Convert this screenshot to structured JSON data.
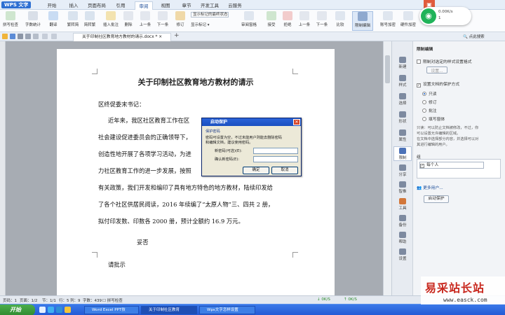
{
  "app": {
    "logo": "WPS 文字",
    "tabs": [
      "开始",
      "插入",
      "页面布局",
      "引用",
      "审阅",
      "视图",
      "章节",
      "开发工具",
      "云服务"
    ],
    "active_tab": "审阅"
  },
  "ribbon": {
    "groups": [
      "拼写检查",
      "字数统计",
      "翻译",
      "繁转简",
      "简转繁",
      "插入批注",
      "删除",
      "上一条",
      "下一条",
      "修订",
      "审阅窗格",
      "接受",
      "拒绝",
      "上一条",
      "下一条",
      "比较",
      "限制编辑",
      "账号加密",
      "硬件加密"
    ],
    "markup_select": "显示标记的最终状态",
    "show_markup": "显示标记"
  },
  "network": {
    "up": "0.00K/s",
    "down": "1"
  },
  "doc_tab": {
    "name": "关于印制社区教育地方教材的请示.docx *"
  },
  "document": {
    "title": "关于印制社区教育地方教材的请示",
    "salutation": "区终促委末书记：",
    "lines": [
      "近年来，我区社区教育工作在区",
      "社会建设促进委员会的正确领导下，",
      "创造性地开展了各项学习活动，为进",
      "力社区教育工作的进一步发展，按照",
      "有关政策，我们开发和编印了具有地方特色的地方教材，陆续印发给",
      "了各个社区供居民阅读，2016 年续编了“太原人物”三、四共 2 册，",
      "拟付印发数、印数各 2000 册，预计全额约 16.9 万元。"
    ],
    "sign": "妥否",
    "closing": "请批示"
  },
  "dialog": {
    "title": "启动保护",
    "section": "保护密码",
    "desc1": "密码可设置为空，不过未能用户则能去删除密码",
    "desc2": "和编辑文档，建议使用密码。",
    "new_pw_label": "新密码(可选)(E):",
    "confirm_pw_label": "确认新密码(E):",
    "ok": "确定",
    "cancel": "取消"
  },
  "side_icons": [
    "新建",
    "样式",
    "选择",
    "形状",
    "属性",
    "限制",
    "分享",
    "智推",
    "工具",
    "备份",
    "帮助",
    "设置"
  ],
  "active_side": "限制",
  "panel": {
    "title": "限制编辑",
    "opt_format": "限制对选定的样式设置格式",
    "settings_btn": "设置...",
    "opt_protect": "设置文档的保护方式",
    "modes": [
      "只读",
      "修订",
      "批注",
      "填写窗体"
    ],
    "selected_mode": "只读",
    "desc": [
      "只读：可以防止文档被修改，不过，你",
      "可以设置允许编辑的区域。",
      "在文档中选择部分内容，并选择可以对",
      "其进行编辑的用户。"
    ],
    "users_label": "组",
    "user_item": "每个人",
    "more_users": "更多用户...",
    "start_btn": "启动保护"
  },
  "status": {
    "page": "页码：1",
    "pages": "页面：1/2",
    "section": "节：1/1",
    "row": "行：5",
    "col": "列：9",
    "words": "字数：439",
    "spell": "拼写检查",
    "net1": "0K/S",
    "net2": "0K/S"
  },
  "taskbar": {
    "start": "开始",
    "items": [
      "Word Excel PPT技",
      "关于印制社区教育",
      "Wps文字怎样设置"
    ]
  },
  "watermark": {
    "line1": "易采站长站",
    "line2": "www.easck.com"
  }
}
